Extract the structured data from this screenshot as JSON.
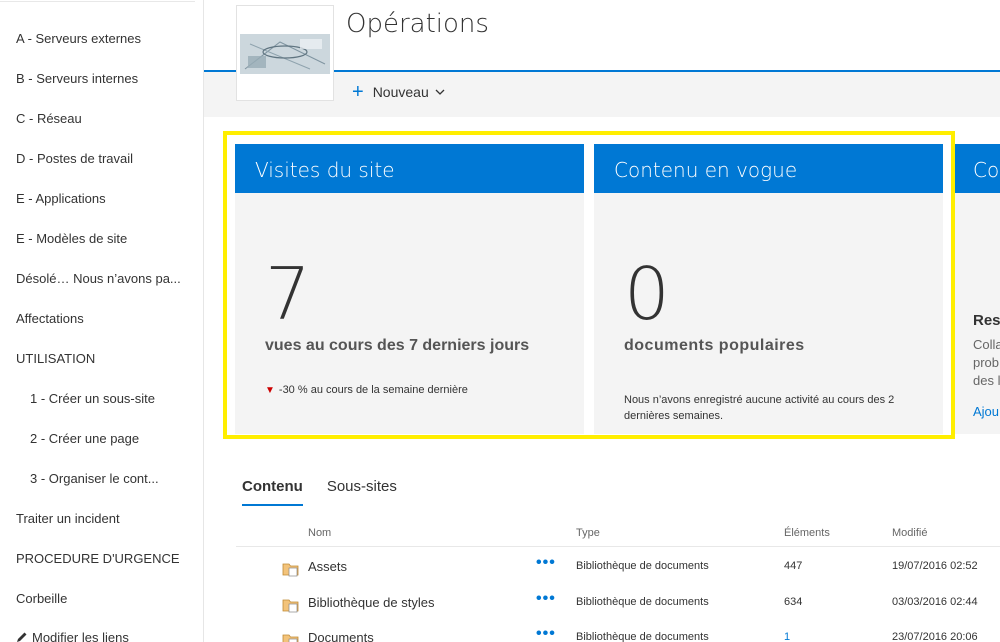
{
  "nav": {
    "items": [
      {
        "label": "A - Serveurs externes",
        "sub": false
      },
      {
        "label": "B - Serveurs internes",
        "sub": false
      },
      {
        "label": "C - Réseau",
        "sub": false
      },
      {
        "label": "D - Postes de travail",
        "sub": false
      },
      {
        "label": "E - Applications",
        "sub": false
      },
      {
        "label": "E - Modèles de site",
        "sub": false
      },
      {
        "label": "Désolé… Nous n’avons pa...",
        "sub": false
      },
      {
        "label": "Affectations",
        "sub": false
      },
      {
        "label": "UTILISATION",
        "sub": false
      },
      {
        "label": "1 - Créer un sous-site",
        "sub": true
      },
      {
        "label": "2 - Créer une page",
        "sub": true
      },
      {
        "label": "3 - Organiser le cont...",
        "sub": true
      },
      {
        "label": "Traiter un incident",
        "sub": false
      },
      {
        "label": "PROCEDURE D'URGENCE",
        "sub": false
      },
      {
        "label": "Corbeille",
        "sub": false
      }
    ],
    "edit_links": "Modifier les liens"
  },
  "header": {
    "title": "Opérations",
    "new_label": "Nouveau"
  },
  "cards": {
    "visits": {
      "title": "Visites du site",
      "value": "7",
      "subtitle": "vues au cours des 7 derniers jours",
      "trend": "-30 % au cours de la semaine dernière"
    },
    "trending": {
      "title": "Contenu en vogue",
      "value": "0",
      "subtitle": "documents populaires",
      "note": "Nous n’avons enregistré aucune activité au cours des 2 dernières semaines."
    },
    "partial": {
      "title": "Co",
      "heading": "Res",
      "lines": [
        "Colla",
        "prob",
        "des l"
      ],
      "link": "Ajou"
    }
  },
  "content": {
    "tabs": [
      "Contenu",
      "Sous-sites"
    ],
    "columns": {
      "name": "Nom",
      "type": "Type",
      "items": "Éléments",
      "modified": "Modifié"
    },
    "rows": [
      {
        "name": "Assets",
        "type": "Bibliothèque de documents",
        "items": "447",
        "modified": "19/07/2016 02:52"
      },
      {
        "name": "Bibliothèque de styles",
        "type": "Bibliothèque de documents",
        "items": "634",
        "modified": "03/03/2016 02:44"
      },
      {
        "name": "Documents",
        "type": "Bibliothèque de documents",
        "items": "1",
        "modified": "23/07/2016 20:06"
      }
    ],
    "more_label": "•••"
  },
  "colors": {
    "accent": "#0078d4",
    "highlight": "#ffee00",
    "trend_down": "#cc0000"
  },
  "icons": [
    "plus-icon",
    "chevron-down-icon",
    "triangle-down-icon",
    "folder-icon",
    "pencil-icon",
    "more-icon"
  ]
}
